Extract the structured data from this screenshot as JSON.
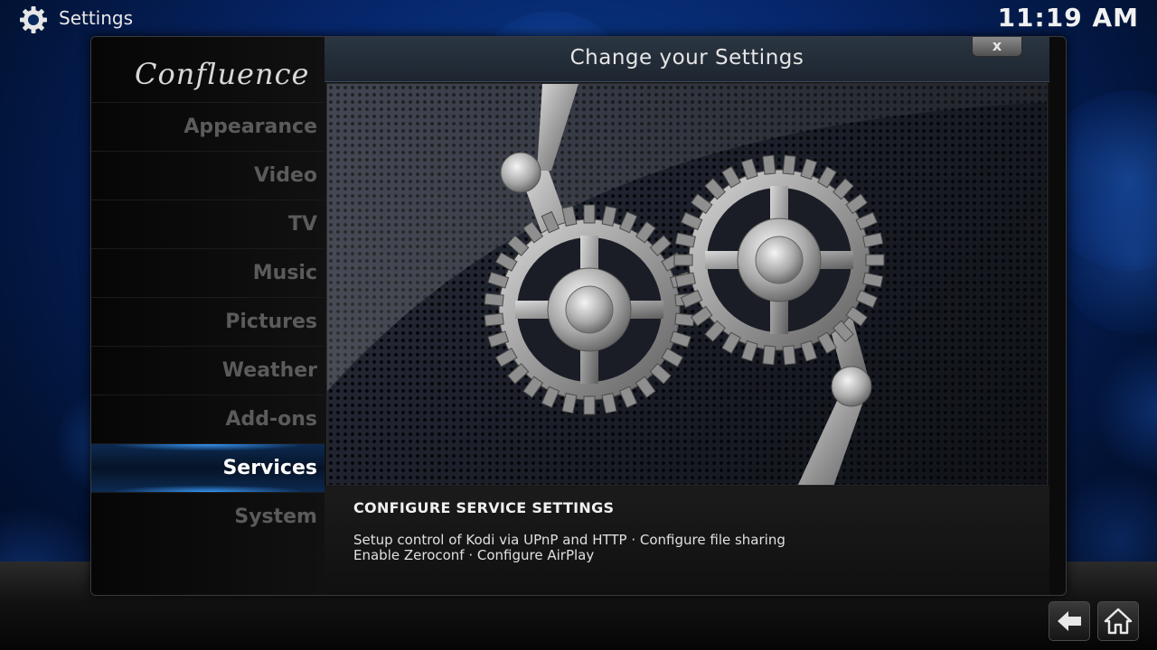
{
  "topbar": {
    "title": "Settings",
    "icon": "gear-icon",
    "clock": "11:19 AM"
  },
  "sidebar": {
    "logo": "Confluence",
    "items": [
      {
        "label": "Appearance",
        "active": false
      },
      {
        "label": "Video",
        "active": false
      },
      {
        "label": "TV",
        "active": false
      },
      {
        "label": "Music",
        "active": false
      },
      {
        "label": "Pictures",
        "active": false
      },
      {
        "label": "Weather",
        "active": false
      },
      {
        "label": "Add-ons",
        "active": false
      },
      {
        "label": "Services",
        "active": true
      },
      {
        "label": "System",
        "active": false
      }
    ]
  },
  "main": {
    "title": "Change your Settings",
    "close_label": "x",
    "description": {
      "title": "CONFIGURE SERVICE SETTINGS",
      "line1": "Setup control of Kodi via UPnP and HTTP · Configure file sharing",
      "line2": "Enable Zeroconf · Configure AirPlay"
    }
  },
  "bottom": {
    "back_icon": "back-arrow-icon",
    "home_icon": "home-icon"
  },
  "colors": {
    "accent": "#3ca0ff",
    "active_text": "#ffffff",
    "inactive_text": "#5b5b5b"
  }
}
